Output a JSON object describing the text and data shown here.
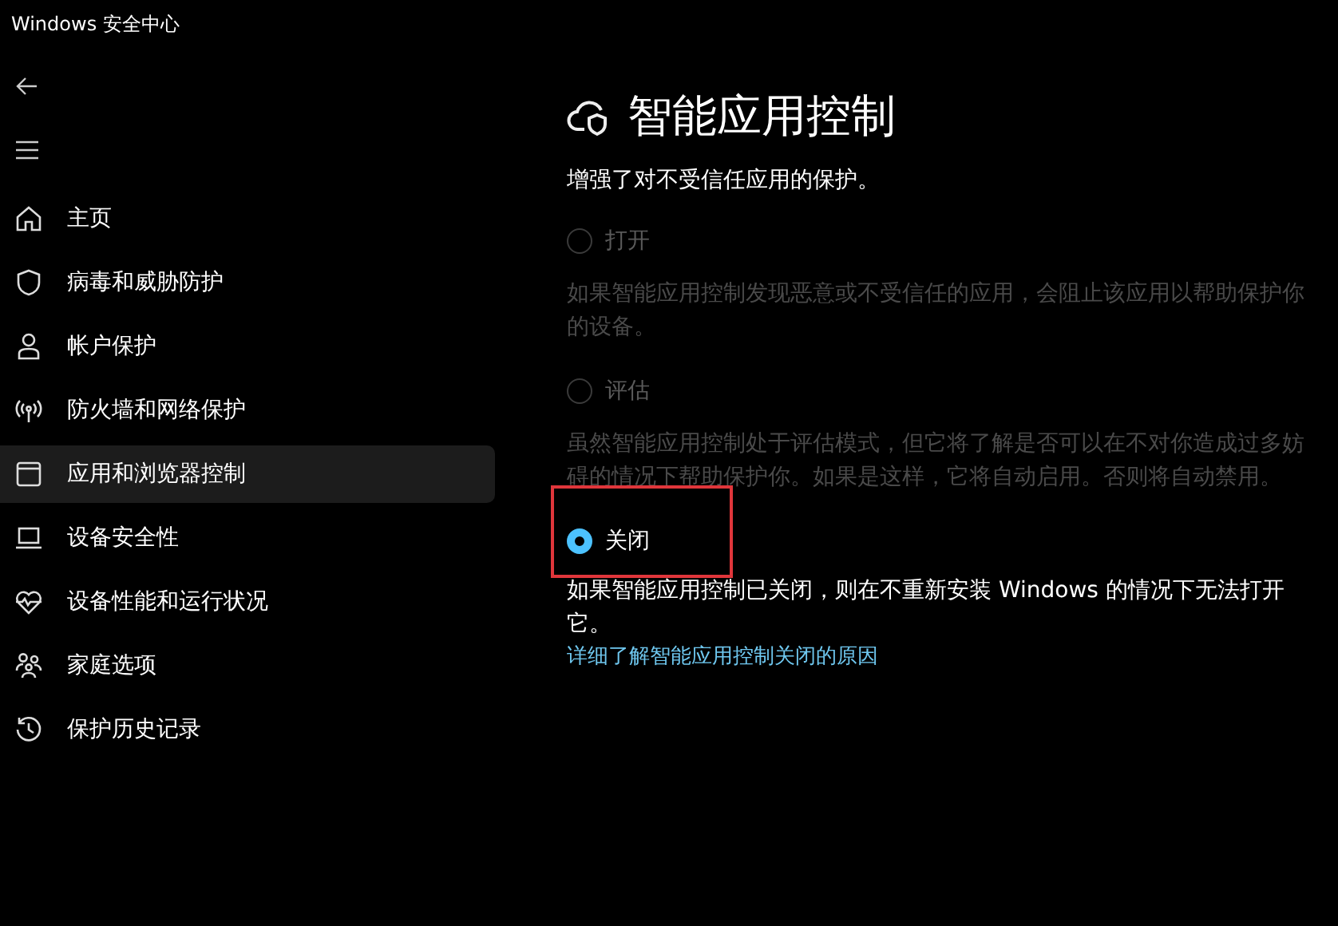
{
  "window": {
    "title": "Windows 安全中心"
  },
  "sidebar": {
    "items": [
      {
        "label": "主页",
        "selected": false
      },
      {
        "label": "病毒和威胁防护",
        "selected": false
      },
      {
        "label": "帐户保护",
        "selected": false
      },
      {
        "label": "防火墙和网络保护",
        "selected": false
      },
      {
        "label": "应用和浏览器控制",
        "selected": true
      },
      {
        "label": "设备安全性",
        "selected": false
      },
      {
        "label": "设备性能和运行状况",
        "selected": false
      },
      {
        "label": "家庭选项",
        "selected": false
      },
      {
        "label": "保护历史记录",
        "selected": false
      }
    ]
  },
  "page": {
    "title": "智能应用控制",
    "subtitle": "增强了对不受信任应用的保护。",
    "options": [
      {
        "label": "打开",
        "selected": false,
        "disabled": true,
        "highlighted": false,
        "description": "如果智能应用控制发现恶意或不受信任的应用，会阻止该应用以帮助保护你的设备。"
      },
      {
        "label": "评估",
        "selected": false,
        "disabled": true,
        "highlighted": false,
        "description": "虽然智能应用控制处于评估模式，但它将了解是否可以在不对你造成过多妨碍的情况下帮助保护你。如果是这样，它将自动启用。否则将自动禁用。"
      },
      {
        "label": "关闭",
        "selected": true,
        "disabled": false,
        "highlighted": true,
        "description": "如果智能应用控制已关闭，则在不重新安装 Windows 的情况下无法打开它。"
      }
    ],
    "link": "详细了解智能应用控制关闭的原因"
  }
}
